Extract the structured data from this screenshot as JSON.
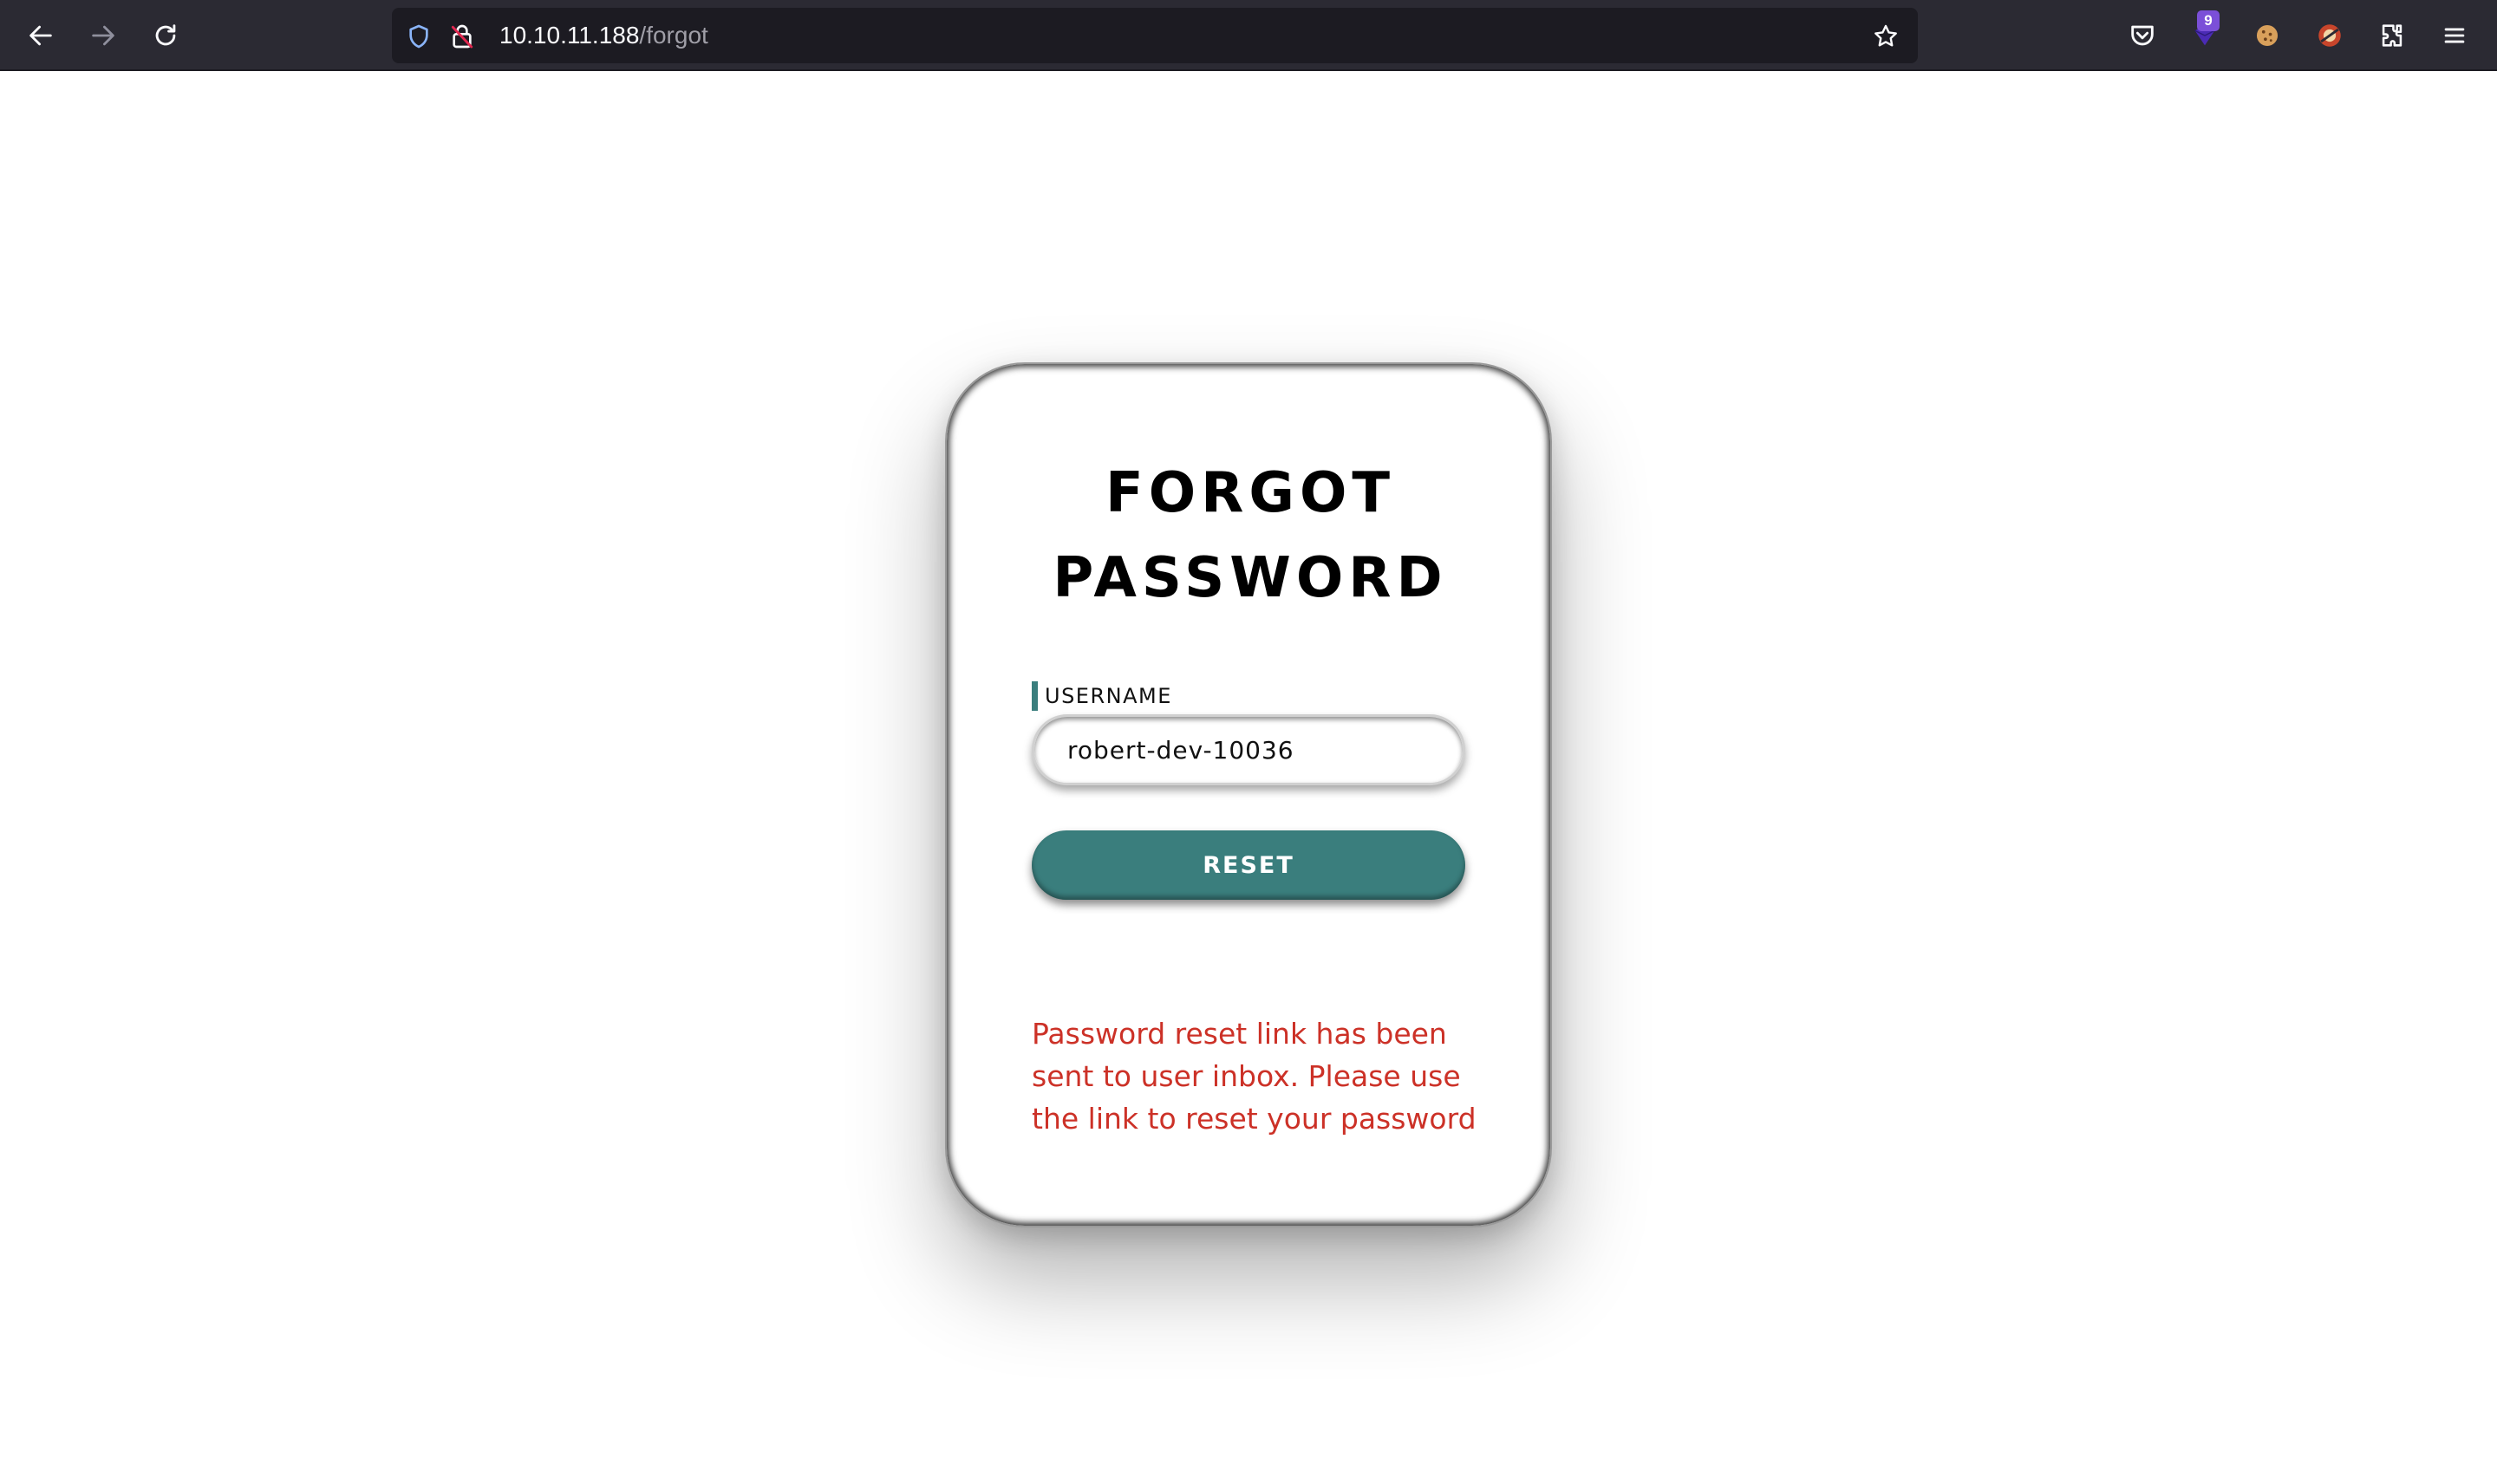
{
  "browser": {
    "url_host": "10.10.11.188",
    "url_path": "/forgot",
    "extension_badge": "9"
  },
  "form": {
    "title_line1": "FORGOT",
    "title_line2": "PASSWORD",
    "username_label": "USERNAME",
    "username_value": "robert-dev-10036",
    "reset_label": "RESET",
    "message": "Password reset link has been sent to user inbox. Please use the link to reset your password"
  },
  "colors": {
    "accent": "#3a7e7d",
    "message": "#cc3127",
    "toolbar": "#2b2a33"
  }
}
